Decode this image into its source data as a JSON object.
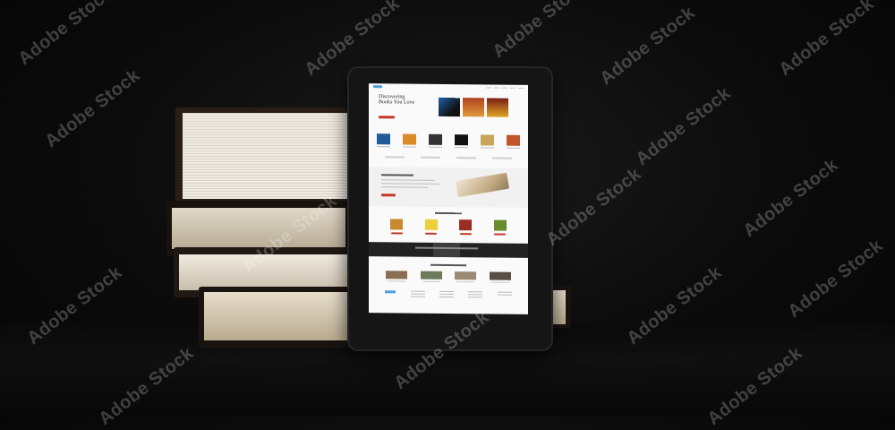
{
  "watermark": {
    "text": "Adobe Stock"
  },
  "screen": {
    "hero_title_line1": "Discovering",
    "hero_title_line2": "Books You Love"
  },
  "colors": {
    "background": "#0b0b0b",
    "tablet_frame": "#151515",
    "screen_bg": "#fafafa",
    "accent_red": "#c0392b",
    "accent_blue": "#4aa0d8"
  }
}
